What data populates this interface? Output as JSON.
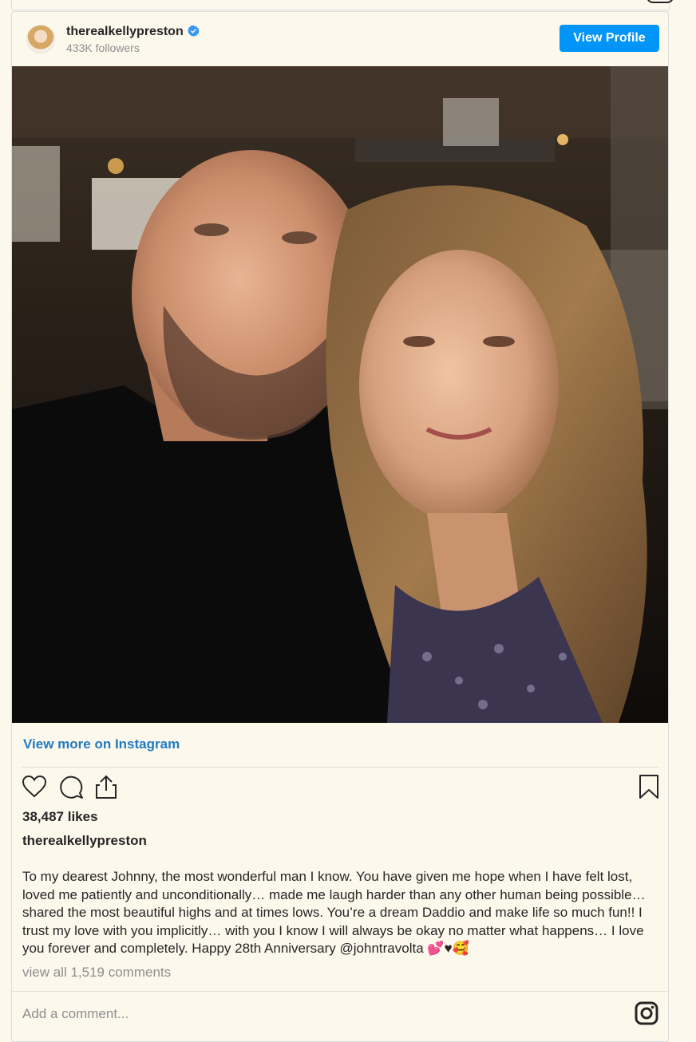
{
  "post": {
    "username": "therealkellypreston",
    "followers": "433K followers",
    "view_profile_label": "View Profile",
    "view_more_label": "View more on Instagram",
    "likes": "38,487 likes",
    "caption_username": "therealkellypreston",
    "caption": "To my dearest Johnny, the most wonderful man I know. You have given me hope when I have felt lost, loved me patiently and unconditionally… made me laugh harder than any other human being possible… shared the most beautiful highs and at times lows. You’re a dream Daddio and make life so much fun!! I trust my love with you implicitly… with you I know I will always be okay no matter what happens… I love you forever and completely. Happy 28th Anniversary @johntravolta 💕♥🥰",
    "comments_link": "view all 1,519 comments",
    "comment_placeholder": "Add a comment...",
    "icons": [
      "verified-badge-icon",
      "heart-icon",
      "comment-icon",
      "share-icon",
      "bookmark-icon",
      "instagram-logo-icon"
    ]
  },
  "colors": {
    "background": "#fdf8ec",
    "accent_blue": "#0095f6",
    "link_blue": "#1f7bc1",
    "muted_text": "#8e8e8e"
  }
}
